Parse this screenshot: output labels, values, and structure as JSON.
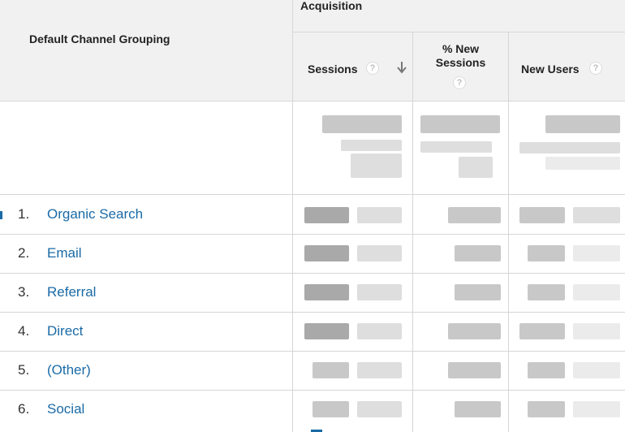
{
  "header": {
    "dimension_label": "Default Channel Grouping",
    "group_label": "Acquisition",
    "columns": [
      {
        "label": "Sessions",
        "help": "?",
        "sort": "descending"
      },
      {
        "label": "% New Sessions",
        "help": "?"
      },
      {
        "label": "New Users",
        "help": "?"
      }
    ]
  },
  "rows": [
    {
      "index": "1.",
      "channel": "Organic Search"
    },
    {
      "index": "2.",
      "channel": "Email"
    },
    {
      "index": "3.",
      "channel": "Referral"
    },
    {
      "index": "4.",
      "channel": "Direct"
    },
    {
      "index": "5.",
      "channel": "(Other)"
    },
    {
      "index": "6.",
      "channel": "Social"
    }
  ],
  "colors": {
    "link": "#1a6aa6",
    "header_bg": "#f1f1f1",
    "border": "#d6d6d6"
  }
}
